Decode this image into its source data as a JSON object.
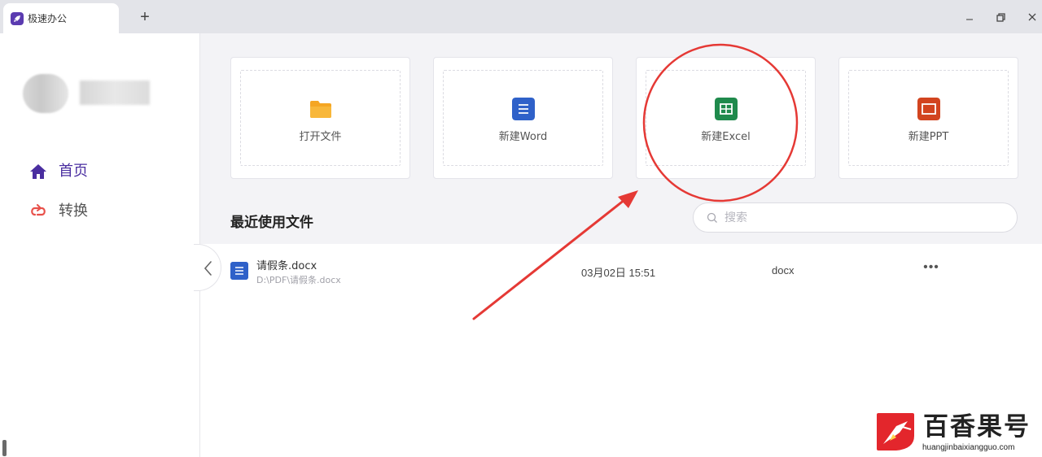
{
  "app": {
    "tab_title": "极速办公",
    "new_tab_symbol": "+"
  },
  "sidebar": {
    "items": [
      {
        "label": "首页",
        "icon": "home-icon",
        "active": true
      },
      {
        "label": "转换",
        "icon": "convert-icon",
        "active": false
      }
    ]
  },
  "quick_actions": [
    {
      "label": "打开文件",
      "icon": "folder-icon",
      "color": "#f5a623"
    },
    {
      "label": "新建Word",
      "icon": "word-doc-icon",
      "color": "#2f61c9"
    },
    {
      "label": "新建Excel",
      "icon": "excel-sheet-icon",
      "color": "#1f8a4c"
    },
    {
      "label": "新建PPT",
      "icon": "ppt-slide-icon",
      "color": "#d2441f"
    }
  ],
  "recent": {
    "title": "最近使用文件",
    "search_placeholder": "搜索",
    "files": [
      {
        "name": "请假条.docx",
        "path": "D:\\PDF\\请假条.docx",
        "date": "03月02日 15:51",
        "type": "docx",
        "more": "•••"
      }
    ]
  },
  "annotation": {
    "color": "#e53935",
    "highlight_target": "新建Excel"
  },
  "watermark": {
    "title": "百香果号",
    "url": "huangjinbaixiangguo.com",
    "logo_color": "#e3262c"
  },
  "colors": {
    "accent": "#4a2ea0",
    "main_bg": "#f3f3f6",
    "titlebar_bg": "#e3e4e9"
  }
}
